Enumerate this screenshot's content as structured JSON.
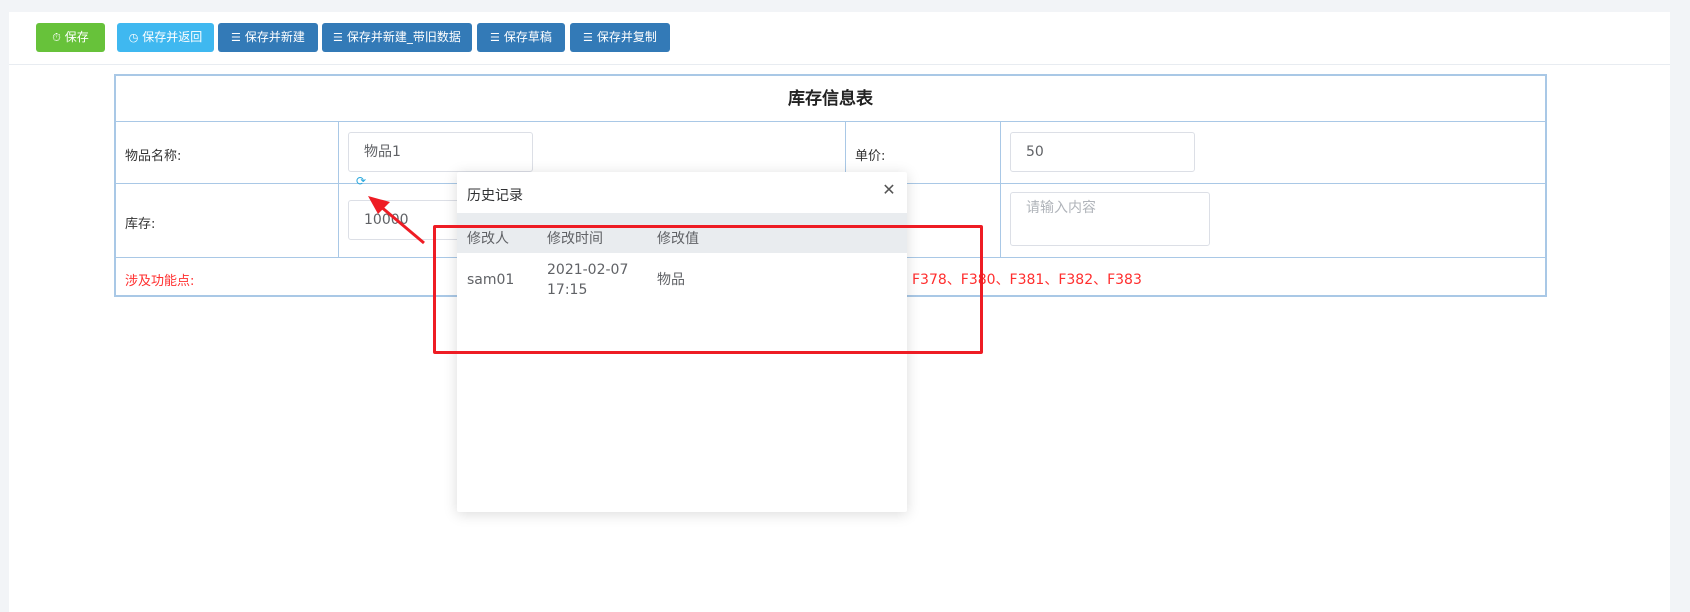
{
  "toolbar": {
    "buttons": [
      {
        "label": "保存",
        "icon": "save-icon"
      },
      {
        "label": "保存并返回",
        "icon": "clock-icon"
      },
      {
        "label": "保存并新建",
        "icon": "list-icon"
      },
      {
        "label": "保存并新建_带旧数据",
        "icon": "list-icon"
      },
      {
        "label": "保存草稿",
        "icon": "list-icon"
      },
      {
        "label": "保存并复制",
        "icon": "list-icon"
      }
    ]
  },
  "form": {
    "title": "库存信息表",
    "fields": {
      "item_name_label": "物品名称:",
      "item_name_value": "物品1",
      "unit_price_label": "单价:",
      "unit_price_value": "50",
      "stock_label": "库存:",
      "stock_value": "10000",
      "note_placeholder": "请输入内容"
    },
    "feature_label": "涉及功能点:",
    "feature_value": "F378、F380、F381、F382、F383"
  },
  "history_popup": {
    "title": "历史记录",
    "columns": [
      "修改人",
      "修改时间",
      "修改值"
    ],
    "rows": [
      {
        "user": "sam01",
        "date": "2021-02-07",
        "time": "17:15",
        "value": "物品"
      }
    ]
  },
  "colors": {
    "btn_green": "#67c23a",
    "btn_cyan": "#3fb8f0",
    "btn_blue": "#337ab7",
    "highlight_red": "#ee1c24",
    "table_border": "#a9c8e6"
  }
}
